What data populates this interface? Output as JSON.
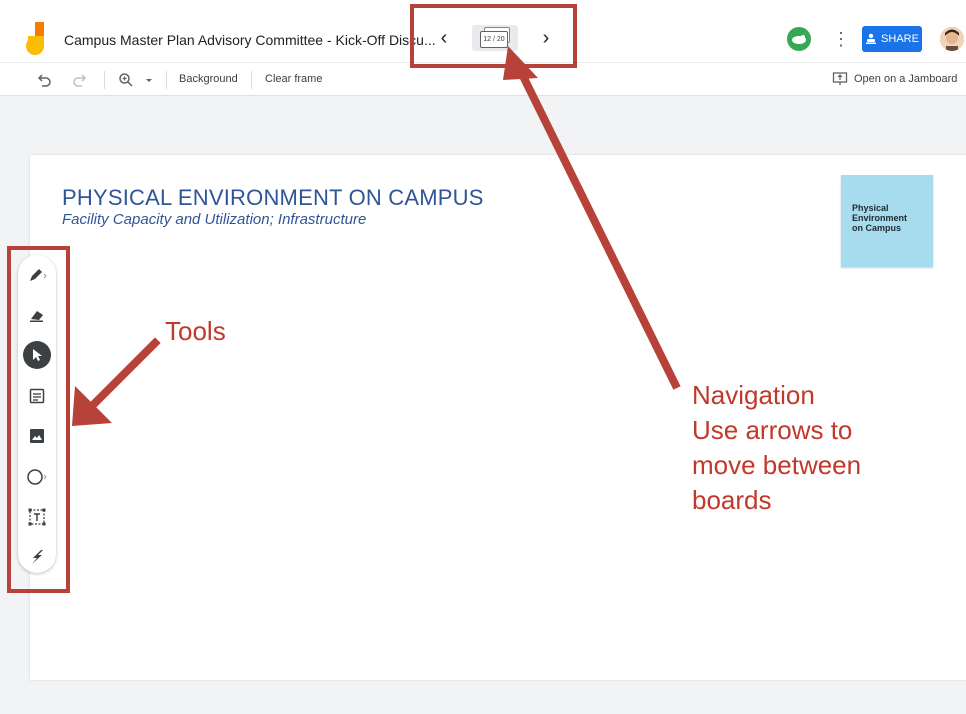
{
  "header": {
    "doc_title": "Campus Master Plan Advisory Committee - Kick-Off Discu...",
    "prev_label": "‹",
    "next_label": "›",
    "frame_counter": "12 / 20",
    "share_label": "SHARE"
  },
  "toolbar": {
    "undo_icon": "undo-icon",
    "redo_icon": "redo-icon",
    "zoom_icon": "zoom-in-icon",
    "background_label": "Background",
    "clear_frame_label": "Clear frame",
    "open_jamboard_label": "Open on a Jamboard"
  },
  "slide": {
    "title": "PHYSICAL ENVIRONMENT ON CAMPUS",
    "subtitle": "Facility Capacity and Utilization; Infrastructure",
    "sticky_line1": "Physical",
    "sticky_line2": "Environment",
    "sticky_line3": "on Campus",
    "sticky_color": "#a6dced"
  },
  "tools": [
    {
      "icon": "pen-icon"
    },
    {
      "icon": "eraser-icon"
    },
    {
      "icon": "select-pointer-icon",
      "active": true
    },
    {
      "icon": "sticky-note-icon"
    },
    {
      "icon": "image-icon"
    },
    {
      "icon": "circle-shape-icon"
    },
    {
      "icon": "text-box-icon"
    },
    {
      "icon": "laser-icon"
    }
  ],
  "annotations": {
    "tools_label": "Tools",
    "nav_line1": "Navigation",
    "nav_line2": "Use arrows to",
    "nav_line3": "move between",
    "nav_line4": "boards",
    "color": "#b6423a"
  },
  "colors": {
    "share_button": "#1a73e8",
    "title_blue": "#2f5597",
    "annotation_red": "#c0392b"
  }
}
